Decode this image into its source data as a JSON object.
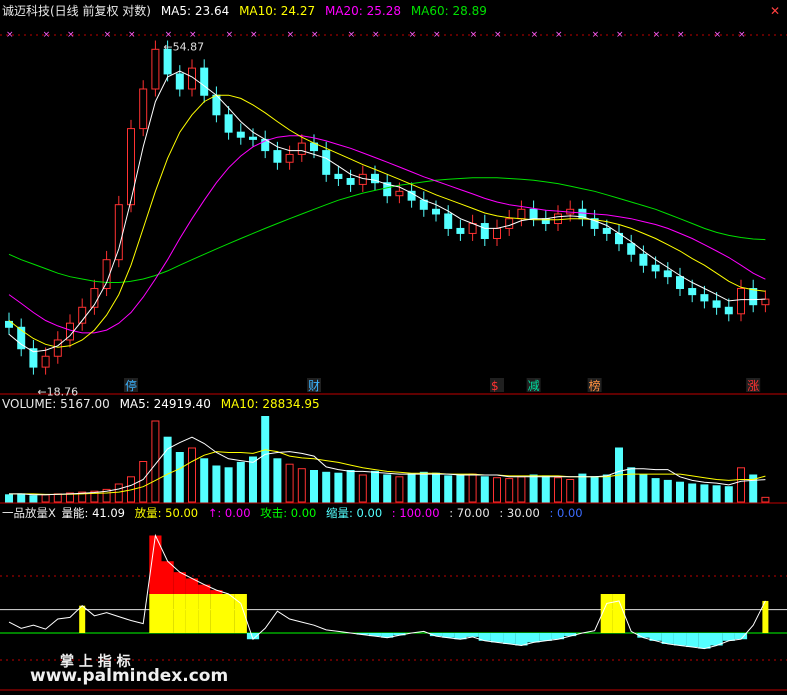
{
  "header": {
    "title": "诚迈科技(日线 前复权 对数)",
    "ma5": "MA5: 23.64",
    "ma10": "MA10: 24.27",
    "ma20": "MA20: 25.28",
    "ma60": "MA60: 28.89",
    "corner": "✕"
  },
  "volume_header": {
    "volume": "VOLUME: 5167.00",
    "ma5": "MA5: 24919.40",
    "ma10": "MA10: 28834.95"
  },
  "indicator_header": {
    "name": "一品放量X",
    "liangneng": "量能: 41.09",
    "fangliang": "放量: 50.00",
    "arrow": "↑: 0.00",
    "gongji": "攻击: 0.00",
    "suoliang": "缩量: 0.00",
    "v100": ": 100.00",
    "v70": ": 70.00",
    "v30": ": 30.00",
    "v0": ": 0.00"
  },
  "watermark": {
    "cn": "掌 上 指 标",
    "url": "www.palmindex.com"
  },
  "colors": {
    "up": "#ff3232",
    "down": "#54ffff",
    "ma5": "#ffffff",
    "ma10": "#ffff00",
    "ma20": "#ff00ff",
    "ma60": "#00e000",
    "grid": "#c00000",
    "yellow": "#ffff00",
    "red": "#ff0000",
    "green": "#00ff00",
    "cyan": "#54ffff",
    "blue": "#3c6cff"
  },
  "chart_data": [
    {
      "type": "candlestick",
      "labels": {
        "high": "54.87",
        "low": "18.76"
      },
      "markers": [
        {
          "x": 10,
          "label": "停",
          "color": "#3cb4ff"
        },
        {
          "x": 25,
          "label": "财",
          "color": "#3cb4ff"
        },
        {
          "x": 40,
          "label": "$",
          "color": "#ff3232"
        },
        {
          "x": 43,
          "label": "减",
          "color": "#00e0a0"
        },
        {
          "x": 48,
          "label": "榜",
          "color": "#ff9040"
        },
        {
          "x": 61,
          "label": "涨",
          "color": "#ff3232"
        }
      ],
      "close": [
        21.5,
        20.0,
        18.8,
        19.5,
        20.6,
        21.8,
        23.0,
        24.5,
        27.0,
        32.5,
        42.0,
        48.0,
        54.87,
        50.5,
        48.0,
        51.5,
        47.0,
        44.0,
        41.5,
        40.8,
        40.5,
        39.0,
        37.5,
        38.5,
        40.0,
        39.0,
        36.0,
        35.5,
        34.8,
        36.0,
        35.0,
        33.5,
        34.0,
        33.0,
        32.0,
        31.5,
        30.0,
        29.5,
        30.5,
        29.0,
        30.0,
        31.0,
        32.0,
        31.0,
        30.5,
        31.5,
        32.0,
        31.0,
        30.0,
        29.5,
        28.5,
        27.5,
        26.5,
        26.0,
        25.5,
        24.5,
        24.0,
        23.5,
        23.0,
        22.5,
        24.5,
        23.2,
        23.64
      ],
      "ma5": [
        21.0,
        20.3,
        19.8,
        19.9,
        20.2,
        20.9,
        22.0,
        23.2,
        25.0,
        28.0,
        33.0,
        39.5,
        46.0,
        50.0,
        51.0,
        50.0,
        48.5,
        47.0,
        45.0,
        43.0,
        41.5,
        40.5,
        39.5,
        39.0,
        39.0,
        38.5,
        38.0,
        37.0,
        36.0,
        35.5,
        35.3,
        34.8,
        34.5,
        33.8,
        33.0,
        32.5,
        31.8,
        31.0,
        30.5,
        30.0,
        30.0,
        30.3,
        30.8,
        31.0,
        31.0,
        31.2,
        31.3,
        31.2,
        30.8,
        30.3,
        29.5,
        28.7,
        27.8,
        27.0,
        26.3,
        25.6,
        25.0,
        24.5,
        24.0,
        23.5,
        23.6,
        23.6,
        23.64
      ],
      "ma10": [
        22.0,
        21.3,
        20.7,
        20.3,
        20.1,
        20.2,
        20.6,
        21.3,
        22.4,
        24.0,
        26.5,
        30.0,
        34.0,
        38.0,
        41.5,
        44.0,
        46.0,
        47.0,
        47.0,
        46.5,
        45.5,
        44.3,
        43.0,
        41.8,
        40.8,
        40.0,
        39.3,
        38.6,
        37.9,
        37.2,
        36.6,
        36.0,
        35.4,
        34.8,
        34.2,
        33.6,
        33.1,
        32.6,
        32.1,
        31.6,
        31.3,
        31.1,
        31.0,
        30.9,
        30.9,
        30.9,
        31.0,
        31.0,
        30.9,
        30.7,
        30.4,
        30.0,
        29.5,
        29.0,
        28.4,
        27.8,
        27.1,
        26.5,
        25.8,
        25.1,
        24.6,
        24.4,
        24.27
      ],
      "ma20": [
        24.0,
        23.3,
        22.6,
        22.0,
        21.6,
        21.3,
        21.1,
        21.1,
        21.3,
        21.8,
        22.6,
        23.8,
        25.3,
        27.0,
        29.0,
        31.0,
        33.0,
        35.0,
        36.8,
        38.3,
        39.5,
        40.3,
        40.8,
        41.0,
        41.0,
        40.7,
        40.3,
        39.8,
        39.3,
        38.7,
        38.1,
        37.5,
        36.9,
        36.3,
        35.7,
        35.2,
        34.7,
        34.2,
        33.7,
        33.2,
        32.8,
        32.5,
        32.3,
        32.1,
        31.9,
        31.8,
        31.7,
        31.6,
        31.5,
        31.4,
        31.2,
        31.0,
        30.7,
        30.4,
        30.0,
        29.5,
        29.0,
        28.4,
        27.8,
        27.2,
        26.5,
        25.8,
        25.28
      ],
      "ma60": [
        27.5,
        27.0,
        26.6,
        26.2,
        25.8,
        25.5,
        25.3,
        25.1,
        25.0,
        25.0,
        25.1,
        25.3,
        25.6,
        26.0,
        26.5,
        27.0,
        27.5,
        28.0,
        28.5,
        29.0,
        29.5,
        30.0,
        30.5,
        31.0,
        31.5,
        32.0,
        32.5,
        33.0,
        33.4,
        33.8,
        34.1,
        34.4,
        34.7,
        34.9,
        35.1,
        35.3,
        35.4,
        35.5,
        35.6,
        35.6,
        35.6,
        35.5,
        35.4,
        35.3,
        35.1,
        34.9,
        34.6,
        34.3,
        34.0,
        33.6,
        33.2,
        32.8,
        32.4,
        32.0,
        31.5,
        31.0,
        30.5,
        30.0,
        29.6,
        29.3,
        29.1,
        28.95,
        28.89
      ]
    },
    {
      "type": "bar",
      "title": "VOLUME",
      "values": [
        8,
        9,
        7,
        8,
        9,
        10,
        11,
        12,
        14,
        20,
        28,
        45,
        90,
        72,
        55,
        60,
        48,
        40,
        38,
        44,
        50,
        95,
        48,
        42,
        37,
        35,
        33,
        32,
        35,
        30,
        34,
        30,
        28,
        31,
        33,
        32,
        29,
        30,
        31,
        28,
        27,
        26,
        28,
        30,
        29,
        27,
        25,
        31,
        28,
        30,
        60,
        38,
        30,
        26,
        24,
        22,
        20,
        19,
        18,
        17,
        38,
        30,
        5.167
      ],
      "ma5": [
        9,
        9,
        8,
        8,
        8.6,
        9,
        9.7,
        10.6,
        12,
        14.4,
        18.4,
        25,
        42,
        59,
        66,
        72,
        65,
        55,
        48,
        46,
        44,
        53,
        55,
        56,
        54,
        51,
        39,
        36,
        34,
        34,
        33,
        32,
        31,
        31,
        31,
        31,
        31,
        30,
        30,
        30,
        30,
        28,
        28,
        28,
        28,
        28,
        28,
        28,
        28,
        29,
        34,
        37,
        37,
        36,
        36,
        28,
        24,
        22,
        21,
        19,
        23,
        24,
        24.92
      ],
      "ma10": [
        9,
        9,
        9,
        8.5,
        8.4,
        8.6,
        9,
        9.5,
        10,
        11,
        13.5,
        17,
        24,
        31,
        37,
        45,
        52,
        56,
        55,
        55,
        54,
        58,
        56,
        51,
        49,
        48,
        46,
        44,
        41,
        38,
        36,
        34,
        33,
        32,
        32,
        32,
        31,
        31,
        31,
        30,
        30,
        29,
        29,
        29,
        29,
        29,
        28,
        28,
        28,
        28,
        30,
        31,
        31,
        31,
        31,
        31,
        29,
        27,
        25,
        24,
        25,
        25,
        28.83
      ]
    },
    {
      "type": "area",
      "title": "一品放量X",
      "series": [
        {
          "name": "量能",
          "values": [
            14,
            6,
            10,
            5,
            18,
            20,
            35,
            22,
            26,
            21,
            16,
            12,
            125,
            92,
            78,
            70,
            62,
            55,
            50,
            38,
            -8,
            6,
            28,
            18,
            14,
            10,
            4,
            2,
            0,
            -2,
            -4,
            -6,
            -3,
            0,
            2,
            -4,
            -6,
            -8,
            -5,
            -10,
            -12,
            -14,
            -16,
            -12,
            -10,
            -8,
            -4,
            0,
            3,
            38,
            41,
            2,
            -6,
            -10,
            -14,
            -16,
            -18,
            -20,
            -16,
            -10,
            -8,
            10,
            41.09
          ]
        },
        {
          "name": "放量",
          "values": [
            0,
            0,
            0,
            0,
            0,
            0,
            0,
            0,
            0,
            0,
            0,
            0,
            50,
            50,
            50,
            50,
            50,
            50,
            50,
            50,
            0,
            0,
            0,
            0,
            0,
            0,
            0,
            0,
            0,
            0,
            0,
            0,
            0,
            0,
            0,
            0,
            0,
            0,
            0,
            0,
            0,
            0,
            0,
            0,
            0,
            0,
            0,
            0,
            0,
            50,
            50,
            0,
            0,
            0,
            0,
            0,
            0,
            0,
            0,
            0,
            0,
            0,
            0
          ]
        }
      ]
    }
  ]
}
